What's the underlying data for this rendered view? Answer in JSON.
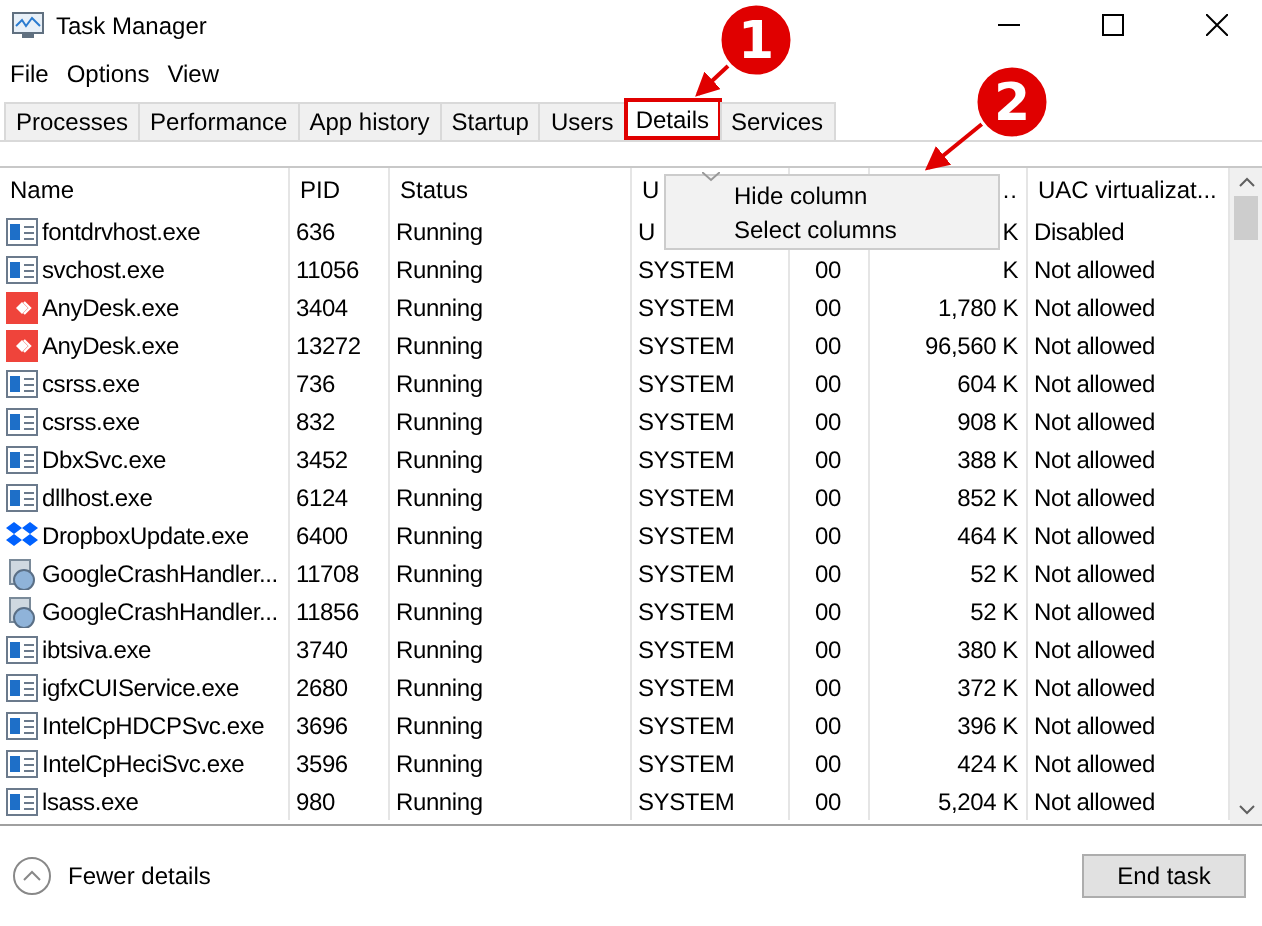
{
  "window": {
    "title": "Task Manager"
  },
  "menu_bar": [
    "File",
    "Options",
    "View"
  ],
  "tabs": [
    {
      "label": "Processes",
      "selected": false,
      "highlighted": false
    },
    {
      "label": "Performance",
      "selected": false,
      "highlighted": false
    },
    {
      "label": "App history",
      "selected": false,
      "highlighted": false
    },
    {
      "label": "Startup",
      "selected": false,
      "highlighted": false
    },
    {
      "label": "Users",
      "selected": false,
      "highlighted": false
    },
    {
      "label": "Details",
      "selected": true,
      "highlighted": true
    },
    {
      "label": "Services",
      "selected": false,
      "highlighted": false
    }
  ],
  "table": {
    "columns": [
      "Name",
      "PID",
      "Status",
      "U",
      "",
      "…",
      "UAC virtualizat..."
    ],
    "rows": [
      {
        "kind": "app",
        "cells": [
          "fontdrvhost.exe",
          "636",
          "Running",
          "U",
          "",
          "K",
          "Disabled"
        ]
      },
      {
        "kind": "app",
        "cells": [
          "svchost.exe",
          "11056",
          "Running",
          "SYSTEM",
          "00",
          "K",
          "Not allowed"
        ]
      },
      {
        "kind": "anydesk",
        "cells": [
          "AnyDesk.exe",
          "3404",
          "Running",
          "SYSTEM",
          "00",
          "1,780 K",
          "Not allowed"
        ]
      },
      {
        "kind": "anydesk",
        "cells": [
          "AnyDesk.exe",
          "13272",
          "Running",
          "SYSTEM",
          "00",
          "96,560 K",
          "Not allowed"
        ]
      },
      {
        "kind": "app",
        "cells": [
          "csrss.exe",
          "736",
          "Running",
          "SYSTEM",
          "00",
          "604 K",
          "Not allowed"
        ]
      },
      {
        "kind": "app",
        "cells": [
          "csrss.exe",
          "832",
          "Running",
          "SYSTEM",
          "00",
          "908 K",
          "Not allowed"
        ]
      },
      {
        "kind": "app",
        "cells": [
          "DbxSvc.exe",
          "3452",
          "Running",
          "SYSTEM",
          "00",
          "388 K",
          "Not allowed"
        ]
      },
      {
        "kind": "app",
        "cells": [
          "dllhost.exe",
          "6124",
          "Running",
          "SYSTEM",
          "00",
          "852 K",
          "Not allowed"
        ]
      },
      {
        "kind": "dropbox",
        "cells": [
          "DropboxUpdate.exe",
          "6400",
          "Running",
          "SYSTEM",
          "00",
          "464 K",
          "Not allowed"
        ]
      },
      {
        "kind": "installer",
        "cells": [
          "GoogleCrashHandler...",
          "11708",
          "Running",
          "SYSTEM",
          "00",
          "52 K",
          "Not allowed"
        ]
      },
      {
        "kind": "installer",
        "cells": [
          "GoogleCrashHandler...",
          "11856",
          "Running",
          "SYSTEM",
          "00",
          "52 K",
          "Not allowed"
        ]
      },
      {
        "kind": "app",
        "cells": [
          "ibtsiva.exe",
          "3740",
          "Running",
          "SYSTEM",
          "00",
          "380 K",
          "Not allowed"
        ]
      },
      {
        "kind": "app",
        "cells": [
          "igfxCUIService.exe",
          "2680",
          "Running",
          "SYSTEM",
          "00",
          "372 K",
          "Not allowed"
        ]
      },
      {
        "kind": "app",
        "cells": [
          "IntelCpHDCPSvc.exe",
          "3696",
          "Running",
          "SYSTEM",
          "00",
          "396 K",
          "Not allowed"
        ]
      },
      {
        "kind": "app",
        "cells": [
          "IntelCpHeciSvc.exe",
          "3596",
          "Running",
          "SYSTEM",
          "00",
          "424 K",
          "Not allowed"
        ]
      },
      {
        "kind": "app",
        "cells": [
          "lsass.exe",
          "980",
          "Running",
          "SYSTEM",
          "00",
          "5,204 K",
          "Not allowed"
        ]
      }
    ]
  },
  "context_menu": [
    "Hide column",
    "Select columns"
  ],
  "footer": {
    "toggle": "Fewer details",
    "button": "End task"
  },
  "annotations": [
    {
      "label": "1"
    },
    {
      "label": "2"
    }
  ]
}
